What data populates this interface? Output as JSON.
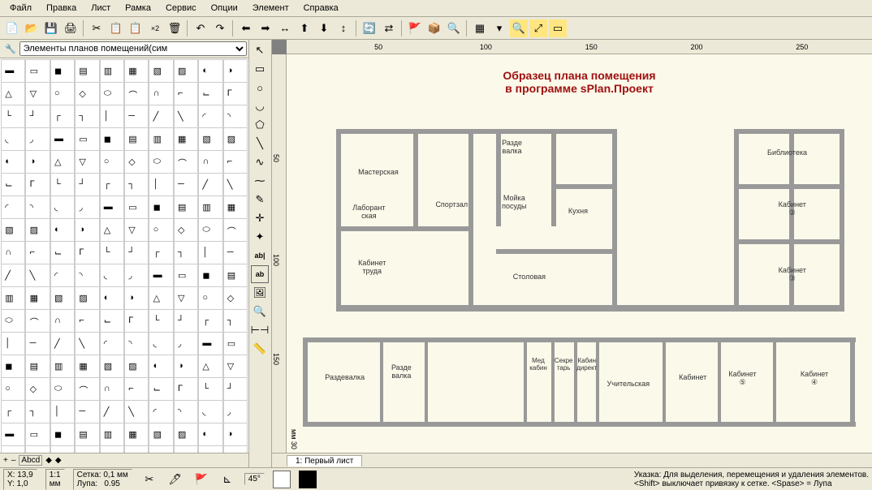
{
  "menu": [
    "Файл",
    "Правка",
    "Лист",
    "Рамка",
    "Сервис",
    "Опции",
    "Элемент",
    "Справка"
  ],
  "library": {
    "dropdown": "Элементы планов помещений(сим",
    "footer_symbols": [
      "+",
      "–",
      "Abcd",
      "◆",
      "◆"
    ]
  },
  "ruler_h": [
    "50",
    "100",
    "150",
    "200",
    "250"
  ],
  "ruler_v": [
    "50",
    "100",
    "150"
  ],
  "canvas": {
    "title_line1": "Образец плана помещения",
    "title_line2": "в программе sPlan.Проект",
    "rooms": {
      "workshop": "Мастерская",
      "sport": "Спортзал",
      "dressing1": "Разде\nвалка",
      "lab": "Лаборант\nская",
      "sink": "Мойка\nпосуды",
      "kitchen": "Кухня",
      "labor_cab": "Кабинет\nтруда",
      "dining": "Столовая",
      "library": "Библиотека",
      "cab2": "Кабинет\n②",
      "cab3": "Кабинет\n③",
      "dressing2": "Раздевалка",
      "dressing3": "Разде\nвалка",
      "med": "Мед\nкабин",
      "sekr": "Секре\nтарь",
      "dir": "Кабин\nдирект",
      "teacher": "Учительская",
      "cab_gen": "Кабинет",
      "cab5": "Кабинет\n⑤",
      "cab4": "Кабинет\n④"
    },
    "margin_label": "мм 30"
  },
  "tabs": [
    "1: Первый лист"
  ],
  "status": {
    "coords": "X: 13,9\nY: 1,0",
    "unit": "1:1\nмм",
    "grid": "Сетка: 0,1 мм\nЛупа:   0.95",
    "angle": "45°",
    "hint": "Указка: Для выделения, перемещения и удаления элементов.\n<Shift> выключает привязку к сетке. <Spase> = Лупа"
  }
}
